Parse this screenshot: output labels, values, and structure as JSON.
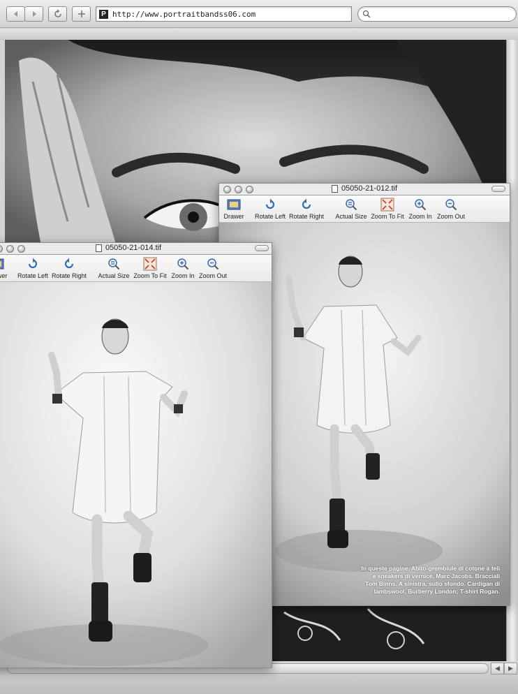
{
  "browser": {
    "url": "http://www.portraitbandss06.com",
    "site_icon_letter": "P",
    "search_placeholder": ""
  },
  "windows": [
    {
      "id": "back",
      "title": "05050-21-012.tif",
      "toolbar": [
        "Drawer",
        "Rotate Left",
        "Rotate Right",
        "Actual Size",
        "Zoom To Fit",
        "Zoom In",
        "Zoom Out"
      ],
      "caption": "In queste pagine. Abito-grembiule di cotone a teli e sneakers di vernice, Marc Jacobs. Bracciali Tom Binns. A sinistra, sullo sfondo. Cardigan di lambswool, Burberry London; T-shirt Rogan."
    },
    {
      "id": "front",
      "title": "05050-21-014.tif",
      "toolbar": [
        "Drawer",
        "Rotate Left",
        "Rotate Right",
        "Actual Size",
        "Zoom To Fit",
        "Zoom In",
        "Zoom Out"
      ]
    }
  ],
  "icons": {
    "back": "back-arrow-icon",
    "forward": "forward-arrow-icon",
    "reload": "reload-icon",
    "add_bookmark": "plus-icon",
    "search": "magnifier-icon"
  }
}
